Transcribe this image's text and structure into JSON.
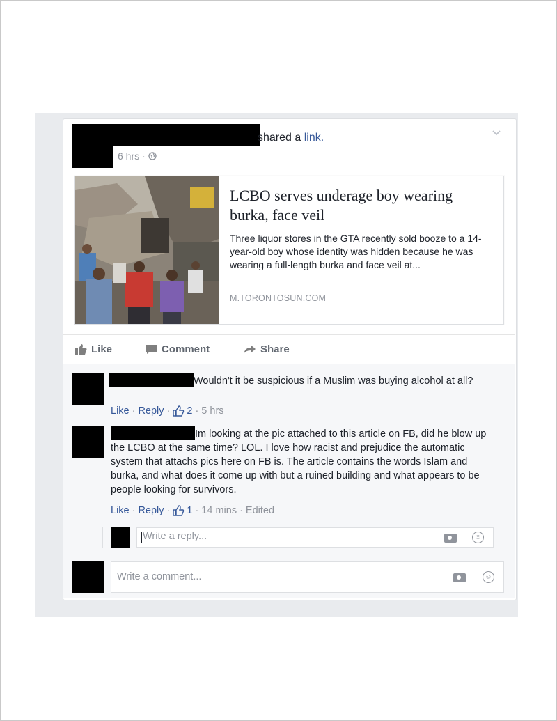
{
  "post": {
    "shared_text": "shared a",
    "shared_link": "link.",
    "timestamp": "6 hrs",
    "separator": "·"
  },
  "link_preview": {
    "title": "LCBO serves underage boy wearing burka, face veil",
    "description": "Three liquor stores in the GTA recently sold booze to a 14-year-old boy whose identity was hidden because he was wearing a full-length burka and face veil at...",
    "domain": "M.TORONTOSUN.COM"
  },
  "actions": {
    "like": "Like",
    "comment": "Comment",
    "share": "Share"
  },
  "comments": [
    {
      "text": "Wouldn't it be suspicious if a Muslim was buying alcohol at all?",
      "like": "Like",
      "reply": "Reply",
      "likes_count": "2",
      "time": "5 hrs",
      "edited": ""
    },
    {
      "text": "Im looking at the pic attached to this article on FB, did he blow up the LCBO at the same time? LOL. I love how racist and prejudice the automatic system that attachs pics here on FB is. The article contains the words Islam and burka, and what does it come up with but a ruined building and what appears to be people looking for survivors.",
      "like": "Like",
      "reply": "Reply",
      "likes_count": "1",
      "time": "14 mins",
      "edited": "Edited"
    }
  ],
  "reply_box": {
    "placeholder": "Write a reply..."
  },
  "comment_box": {
    "placeholder": "Write a comment..."
  },
  "colors": {
    "link": "#365899",
    "muted": "#90949c",
    "text": "#1d2129"
  }
}
